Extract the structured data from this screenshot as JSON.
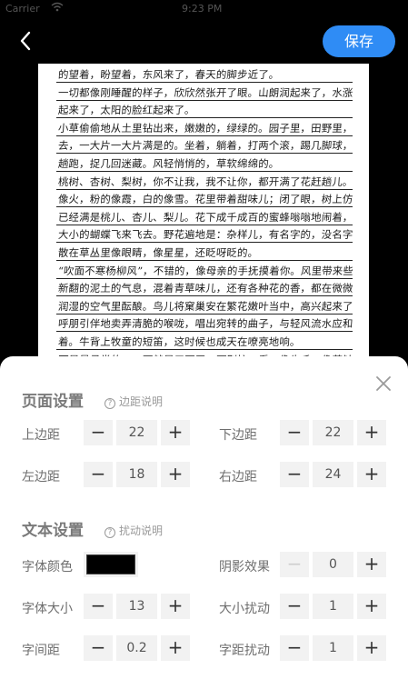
{
  "status_bar": {
    "carrier": "Carrier",
    "time": "9:23 PM"
  },
  "header": {
    "save_label": "保存"
  },
  "paper": {
    "lines": [
      "的望着，盼望着，东风来了，春天的脚步近了。",
      "一切都像刚睡醒的样子，欣欣然张开了眼。山朗润起来了，水涨",
      "起来了，太阳的脸红起来了。",
      "小草偷偷地从土里钻出来，嫩嫩的，绿绿的。园子里，田野里，瞧",
      "去，一大片一大片满是的。坐着，躺着，打两个滚，踢几脚球，赛几",
      "趟跑，捉几回迷藏。风轻悄悄的，草软绵绵的。",
      "桃树、杏树、梨树，你不让我，我不让你，都开满了花赶趟儿。红的",
      "像火，粉的像霞，白的像雪。花里带着甜味儿；闭了眼，树上仿佛",
      "已经满是桃儿、杏儿、梨儿。花下成千成百的蜜蜂嗡嗡地闹着，",
      "大小的蝴蝶飞来飞去。野花遍地是：杂样儿，有名字的，没名字的，",
      "散在草丛里像眼睛，像星星，还眨呀眨的。",
      "“吹面不寒杨柳风”，不错的，像母亲的手抚摸着你。风里带来些",
      "新翻的泥土的气息，混着青草味儿，还有各种花的香，都在微微",
      "润湿的空气里酝酿。鸟儿将窠巢安在繁花嫩叶当中，高兴起来了，",
      "呼朋引伴地卖弄清脆的喉咙，唱出宛转的曲子，与轻风流水应和",
      "着。牛背上牧童的短笛，这时候也成天在嘹亮地响。",
      "雨是最寻常的，一下就是三两天。可别恼。看，像牛毛，像花针，像"
    ]
  },
  "sheet": {
    "page_section": {
      "title": "页面设置",
      "help": "边距说明"
    },
    "top_margin": {
      "label": "上边距",
      "value": "22"
    },
    "bottom_margin": {
      "label": "下边距",
      "value": "22"
    },
    "left_margin": {
      "label": "左边距",
      "value": "18"
    },
    "right_margin": {
      "label": "右边距",
      "value": "24"
    },
    "text_section": {
      "title": "文本设置",
      "help": "扰动说明"
    },
    "font_color": {
      "label": "字体颜色",
      "color": "#000000"
    },
    "shadow": {
      "label": "阴影效果",
      "value": "0"
    },
    "font_size": {
      "label": "字体大小",
      "value": "13"
    },
    "size_jitter": {
      "label": "大小扰动",
      "value": "1"
    },
    "char_spacing": {
      "label": "字间距",
      "value": "0.2"
    },
    "spacing_jitter": {
      "label": "字距扰动",
      "value": "1"
    }
  },
  "colors": {
    "accent": "#2f8cf5",
    "background": "#000000",
    "sheet": "#ffffff"
  }
}
